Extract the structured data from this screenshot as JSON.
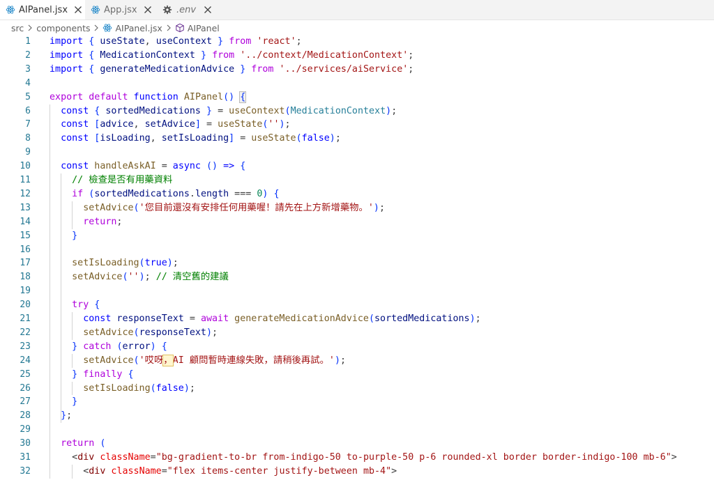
{
  "tabs": [
    {
      "label": "AIPanel.jsx",
      "icon": "react-icon",
      "active": true
    },
    {
      "label": "App.jsx",
      "icon": "react-icon",
      "active": false
    },
    {
      "label": ".env",
      "icon": "gear-icon",
      "active": false
    }
  ],
  "breadcrumb": {
    "items": [
      "src",
      "components",
      "AIPanel.jsx",
      "AIPanel"
    ]
  },
  "editor": {
    "lines": [
      {
        "n": "1",
        "tokens": [
          [
            "k",
            "import"
          ],
          [
            "p",
            " "
          ],
          [
            "b",
            "{"
          ],
          [
            "p",
            " "
          ],
          [
            "v",
            "useState"
          ],
          [
            "p",
            ", "
          ],
          [
            "v",
            "useContext"
          ],
          [
            "p",
            " "
          ],
          [
            "b",
            "}"
          ],
          [
            "p",
            " "
          ],
          [
            "c",
            "from"
          ],
          [
            "p",
            " "
          ],
          [
            "s",
            "'react'"
          ],
          [
            "p",
            ";"
          ]
        ]
      },
      {
        "n": "2",
        "tokens": [
          [
            "k",
            "import"
          ],
          [
            "p",
            " "
          ],
          [
            "b",
            "{"
          ],
          [
            "p",
            " "
          ],
          [
            "v",
            "MedicationContext"
          ],
          [
            "p",
            " "
          ],
          [
            "b",
            "}"
          ],
          [
            "p",
            " "
          ],
          [
            "c",
            "from"
          ],
          [
            "p",
            " "
          ],
          [
            "s",
            "'../context/MedicationContext'"
          ],
          [
            "p",
            ";"
          ]
        ]
      },
      {
        "n": "3",
        "tokens": [
          [
            "k",
            "import"
          ],
          [
            "p",
            " "
          ],
          [
            "b",
            "{"
          ],
          [
            "p",
            " "
          ],
          [
            "v",
            "generateMedicationAdvice"
          ],
          [
            "p",
            " "
          ],
          [
            "b",
            "}"
          ],
          [
            "p",
            " "
          ],
          [
            "c",
            "from"
          ],
          [
            "p",
            " "
          ],
          [
            "s",
            "'../services/aiService'"
          ],
          [
            "p",
            ";"
          ]
        ]
      },
      {
        "n": "4",
        "tokens": []
      },
      {
        "n": "5",
        "tokens": [
          [
            "c",
            "export"
          ],
          [
            "p",
            " "
          ],
          [
            "c",
            "default"
          ],
          [
            "p",
            " "
          ],
          [
            "k",
            "function"
          ],
          [
            "p",
            " "
          ],
          [
            "f",
            "AIPanel"
          ],
          [
            "b",
            "()"
          ],
          [
            "p",
            " "
          ],
          [
            "bh",
            "{"
          ]
        ]
      },
      {
        "n": "6",
        "tokens": [
          [
            "p",
            "  "
          ],
          [
            "k",
            "const"
          ],
          [
            "p",
            " "
          ],
          [
            "b",
            "{"
          ],
          [
            "p",
            " "
          ],
          [
            "v",
            "sortedMedications"
          ],
          [
            "p",
            " "
          ],
          [
            "b",
            "}"
          ],
          [
            "p",
            " = "
          ],
          [
            "f",
            "useContext"
          ],
          [
            "b",
            "("
          ],
          [
            "ta",
            "MedicationContext"
          ],
          [
            "b",
            ")"
          ],
          [
            "p",
            ";"
          ]
        ]
      },
      {
        "n": "7",
        "tokens": [
          [
            "p",
            "  "
          ],
          [
            "k",
            "const"
          ],
          [
            "p",
            " "
          ],
          [
            "b",
            "["
          ],
          [
            "v",
            "advice"
          ],
          [
            "p",
            ", "
          ],
          [
            "v",
            "setAdvice"
          ],
          [
            "b",
            "]"
          ],
          [
            "p",
            " = "
          ],
          [
            "f",
            "useState"
          ],
          [
            "b",
            "("
          ],
          [
            "s",
            "''"
          ],
          [
            "b",
            ")"
          ],
          [
            "p",
            ";"
          ]
        ]
      },
      {
        "n": "8",
        "tokens": [
          [
            "p",
            "  "
          ],
          [
            "k",
            "const"
          ],
          [
            "p",
            " "
          ],
          [
            "b",
            "["
          ],
          [
            "v",
            "isLoading"
          ],
          [
            "p",
            ", "
          ],
          [
            "v",
            "setIsLoading"
          ],
          [
            "b",
            "]"
          ],
          [
            "p",
            " = "
          ],
          [
            "f",
            "useState"
          ],
          [
            "b",
            "("
          ],
          [
            "k",
            "false"
          ],
          [
            "b",
            ")"
          ],
          [
            "p",
            ";"
          ]
        ]
      },
      {
        "n": "9",
        "tokens": []
      },
      {
        "n": "10",
        "tokens": [
          [
            "p",
            "  "
          ],
          [
            "k",
            "const"
          ],
          [
            "p",
            " "
          ],
          [
            "f",
            "handleAskAI"
          ],
          [
            "p",
            " = "
          ],
          [
            "k",
            "async"
          ],
          [
            "p",
            " "
          ],
          [
            "b",
            "()"
          ],
          [
            "p",
            " "
          ],
          [
            "k",
            "=>"
          ],
          [
            "p",
            " "
          ],
          [
            "b",
            "{"
          ]
        ]
      },
      {
        "n": "11",
        "tokens": [
          [
            "p",
            "    "
          ],
          [
            "m",
            "// 檢查是否有用藥資料"
          ]
        ]
      },
      {
        "n": "12",
        "tokens": [
          [
            "p",
            "    "
          ],
          [
            "c",
            "if"
          ],
          [
            "p",
            " "
          ],
          [
            "b",
            "("
          ],
          [
            "v",
            "sortedMedications"
          ],
          [
            "p",
            "."
          ],
          [
            "v",
            "length"
          ],
          [
            "p",
            " === "
          ],
          [
            "n",
            "0"
          ],
          [
            "b",
            ")"
          ],
          [
            "p",
            " "
          ],
          [
            "b",
            "{"
          ]
        ]
      },
      {
        "n": "13",
        "tokens": [
          [
            "p",
            "      "
          ],
          [
            "f",
            "setAdvice"
          ],
          [
            "b",
            "("
          ],
          [
            "s",
            "'您目前還沒有安排任何用藥喔！請先在上方新增藥物。'"
          ],
          [
            "b",
            ")"
          ],
          [
            "p",
            ";"
          ]
        ]
      },
      {
        "n": "14",
        "tokens": [
          [
            "p",
            "      "
          ],
          [
            "c",
            "return"
          ],
          [
            "p",
            ";"
          ]
        ]
      },
      {
        "n": "15",
        "tokens": [
          [
            "p",
            "    "
          ],
          [
            "b",
            "}"
          ]
        ]
      },
      {
        "n": "16",
        "tokens": []
      },
      {
        "n": "17",
        "tokens": [
          [
            "p",
            "    "
          ],
          [
            "f",
            "setIsLoading"
          ],
          [
            "b",
            "("
          ],
          [
            "k",
            "true"
          ],
          [
            "b",
            ")"
          ],
          [
            "p",
            ";"
          ]
        ]
      },
      {
        "n": "18",
        "tokens": [
          [
            "p",
            "    "
          ],
          [
            "f",
            "setAdvice"
          ],
          [
            "b",
            "("
          ],
          [
            "s",
            "''"
          ],
          [
            "b",
            ")"
          ],
          [
            "p",
            "; "
          ],
          [
            "m",
            "// 清空舊的建議"
          ]
        ]
      },
      {
        "n": "19",
        "tokens": []
      },
      {
        "n": "20",
        "tokens": [
          [
            "p",
            "    "
          ],
          [
            "c",
            "try"
          ],
          [
            "p",
            " "
          ],
          [
            "b",
            "{"
          ]
        ]
      },
      {
        "n": "21",
        "tokens": [
          [
            "p",
            "      "
          ],
          [
            "k",
            "const"
          ],
          [
            "p",
            " "
          ],
          [
            "v",
            "responseText"
          ],
          [
            "p",
            " = "
          ],
          [
            "c",
            "await"
          ],
          [
            "p",
            " "
          ],
          [
            "f",
            "generateMedicationAdvice"
          ],
          [
            "b",
            "("
          ],
          [
            "v",
            "sortedMedications"
          ],
          [
            "b",
            ")"
          ],
          [
            "p",
            ";"
          ]
        ]
      },
      {
        "n": "22",
        "tokens": [
          [
            "p",
            "      "
          ],
          [
            "f",
            "setAdvice"
          ],
          [
            "b",
            "("
          ],
          [
            "v",
            "responseText"
          ],
          [
            "b",
            ")"
          ],
          [
            "p",
            ";"
          ]
        ]
      },
      {
        "n": "23",
        "tokens": [
          [
            "p",
            "    "
          ],
          [
            "b",
            "}"
          ],
          [
            "p",
            " "
          ],
          [
            "c",
            "catch"
          ],
          [
            "p",
            " "
          ],
          [
            "b",
            "("
          ],
          [
            "v",
            "error"
          ],
          [
            "b",
            ")"
          ],
          [
            "p",
            " "
          ],
          [
            "b",
            "{"
          ]
        ]
      },
      {
        "n": "24",
        "tokens": [
          [
            "p",
            "      "
          ],
          [
            "f",
            "setAdvice"
          ],
          [
            "b",
            "("
          ],
          [
            "s",
            "'哎呀"
          ],
          [
            "hl",
            "，"
          ],
          [
            "s",
            "AI 顧問暫時連線失敗，請稍後再試。'"
          ],
          [
            "b",
            ")"
          ],
          [
            "p",
            ";"
          ]
        ]
      },
      {
        "n": "25",
        "tokens": [
          [
            "p",
            "    "
          ],
          [
            "b",
            "}"
          ],
          [
            "p",
            " "
          ],
          [
            "c",
            "finally"
          ],
          [
            "p",
            " "
          ],
          [
            "b",
            "{"
          ]
        ]
      },
      {
        "n": "26",
        "tokens": [
          [
            "p",
            "      "
          ],
          [
            "f",
            "setIsLoading"
          ],
          [
            "b",
            "("
          ],
          [
            "k",
            "false"
          ],
          [
            "b",
            ")"
          ],
          [
            "p",
            ";"
          ]
        ]
      },
      {
        "n": "27",
        "tokens": [
          [
            "p",
            "    "
          ],
          [
            "b",
            "}"
          ]
        ]
      },
      {
        "n": "28",
        "tokens": [
          [
            "p",
            "  "
          ],
          [
            "b",
            "}"
          ],
          [
            "p",
            ";"
          ]
        ]
      },
      {
        "n": "29",
        "tokens": []
      },
      {
        "n": "30",
        "tokens": [
          [
            "p",
            "  "
          ],
          [
            "c",
            "return"
          ],
          [
            "p",
            " "
          ],
          [
            "b",
            "("
          ]
        ]
      },
      {
        "n": "31",
        "tokens": [
          [
            "p",
            "    "
          ],
          [
            "p",
            "<"
          ],
          [
            "t",
            "div"
          ],
          [
            "p",
            " "
          ],
          [
            "a",
            "className"
          ],
          [
            "p",
            "="
          ],
          [
            "s",
            "\"bg-gradient-to-br from-indigo-50 to-purple-50 p-6 rounded-xl border border-indigo-100 mb-6\""
          ],
          [
            "p",
            ">"
          ]
        ]
      },
      {
        "n": "32",
        "tokens": [
          [
            "p",
            "      "
          ],
          [
            "p",
            "<"
          ],
          [
            "t",
            "div"
          ],
          [
            "p",
            " "
          ],
          [
            "a",
            "className"
          ],
          [
            "p",
            "="
          ],
          [
            "s",
            "\"flex items-center justify-between mb-4\""
          ],
          [
            "p",
            ">"
          ]
        ]
      }
    ]
  },
  "colors": {
    "keyword": "#0000ff",
    "control": "#af00db",
    "string": "#a31515",
    "variable": "#001080",
    "function": "#795e26",
    "comment": "#008000",
    "number": "#098658",
    "bracket": "#0431fa",
    "tag": "#800000",
    "attribute": "#e50000",
    "line_number": "#237893",
    "react": "#1a85c8"
  }
}
